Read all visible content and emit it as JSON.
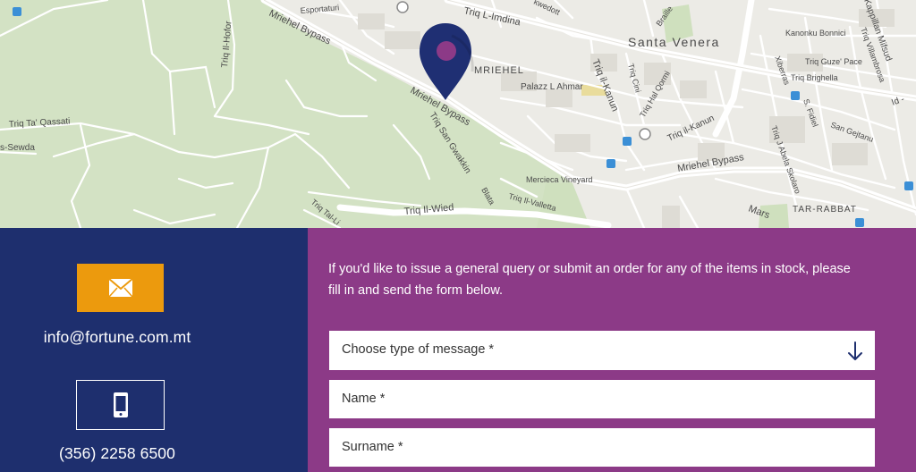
{
  "map": {
    "labels": {
      "santa_venera": "Santa Venera",
      "triq_l_imdina": "Triq L-Imdina",
      "mriehel_bypass_upper": "Mriehel Bypass",
      "mriehel_bypass_mid": "Mriehel Bypass",
      "mriehel_bypass_right": "Mriehel Bypass",
      "mriehel": "MRIEHEL",
      "palazz_l_ahmar": "Palazz L Ahmar",
      "triq_il_kanun": "Triq il-Kanun",
      "triq_il_kanun_2": "Triq il-Kanun",
      "triq_il_hofor": "Triq Il-Hofor",
      "triq_ta_qassati": "Triq Ta' Qassati",
      "sewda": "s-Sewda",
      "triq_san_gwakkin": "Triq San Gwakkin",
      "mercieca_vineyard": "Mercieca Vineyard",
      "triq_il_wied": "Triq Il-Wied",
      "triq_il_valletta": "Triq Il-Valletta",
      "triq_tal_li": "Triq Tal-Li",
      "blata": "Blata",
      "tar_rabbat": "TAR-RABBAT",
      "kanonku_bonnici": "Kanonku Bonnici",
      "triq_guze_pace": "Triq Guze' Pace",
      "triq_brighella": "Triq Brighella",
      "san_gejtanu": "San Gejtanu",
      "esportaturi": "Esportaturi",
      "kappillan_mifsud": "Kappillan Mifsud",
      "triq_villambrosa": "Triq Villambrosa",
      "xiberras": "Xiberras",
      "fidiel": "S. Fidiel",
      "triq_j_abela_skolaro": "Triq J Abela Skolaro",
      "triq_hal_qormi": "Triq Hal Qormi",
      "triq_cini": "Triq Cini",
      "braille": "Braille",
      "marsa": "Mars",
      "id": "Id -",
      "mwedott": "kwedott"
    },
    "marker": {
      "color": "#1f2f73",
      "dot_color": "#8c3a87"
    }
  },
  "contact": {
    "email_icon": "envelope-icon",
    "email": "info@fortune.com.mt",
    "phone_icon": "mobile-phone-icon",
    "phone": "(356) 2258 6500"
  },
  "form": {
    "intro": "If you'd like to issue a general query or submit an order for any of the items in stock, please fill in and send the form below.",
    "message_type_placeholder": "Choose type of message *",
    "select_icon": "arrow-down-icon",
    "name_placeholder": "Name *",
    "surname_placeholder": "Surname *"
  },
  "colors": {
    "contact_bg": "#1e2f6e",
    "form_bg": "#8c3a87",
    "email_button": "#ec9a0d"
  }
}
